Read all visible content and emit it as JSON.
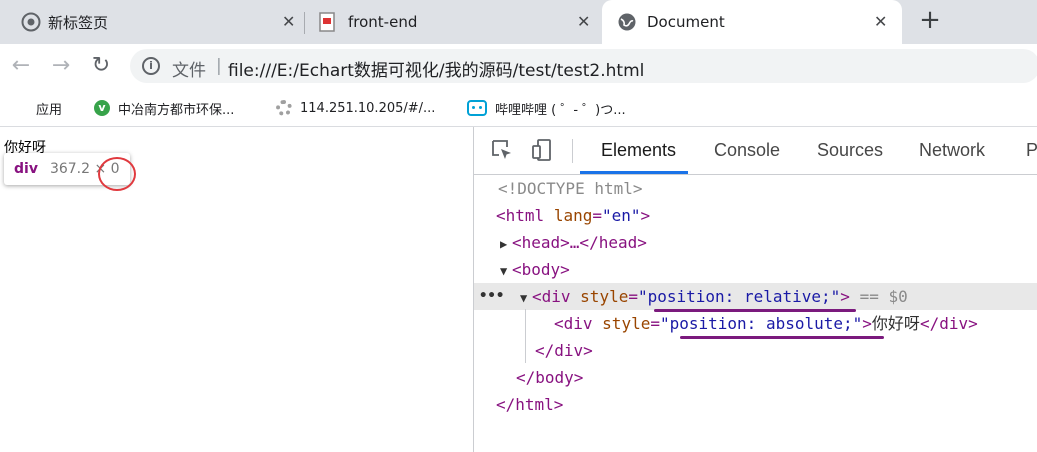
{
  "tabs": [
    {
      "title": "新标签页",
      "icon": "chrome-icon"
    },
    {
      "title": "front-end",
      "icon": "page-icon"
    },
    {
      "title": "Document",
      "icon": "globe-icon",
      "active": true
    }
  ],
  "new_tab_label": "+",
  "toolbar": {
    "back": "←",
    "forward": "→",
    "reload": "↻",
    "scheme_label": "文件",
    "separator": "|",
    "url": "file:///E:/Echart数据可视化/我的源码/test/test2.html"
  },
  "bookmarks": [
    {
      "label": "应用",
      "icon": "apps-icon"
    },
    {
      "label": "中冶南方都市环保...",
      "icon": "v-site-icon"
    },
    {
      "label": "114.251.10.205/#/...",
      "icon": "gear-icon"
    },
    {
      "label": "哔哩哔哩 ( ゜- ゜)つ...",
      "icon": "bilibili-icon"
    }
  ],
  "page": {
    "text": "你好呀",
    "tooltip_tag": "div",
    "tooltip_dims": "367.2 × 0"
  },
  "devtools": {
    "tabs": [
      "Elements",
      "Console",
      "Sources",
      "Network",
      "Pe"
    ],
    "active_tab": "Elements",
    "lines": {
      "doctype": "<!DOCTYPE html>",
      "html_open": "<html",
      "lang_attr": "lang",
      "lang_val": "\"en\"",
      "head": "<head>…</head>",
      "body_open": "<body>",
      "div_open": "<div",
      "style_attr": "style",
      "div1_style": "\"position: relative;\"",
      "selected_marker": "== $0",
      "div2_style": "\"position: absolute;\"",
      "div2_text": "你好呀",
      "div_close": "</div>",
      "body_close": "</body>",
      "html_close": "</html>",
      "ellipsis": "•••"
    }
  },
  "colors": {
    "tab_bg": "#dee1e6",
    "accent": "#1a73e8",
    "annotation_purple": "#7b1a7d",
    "annotation_red": "#e0393e"
  }
}
